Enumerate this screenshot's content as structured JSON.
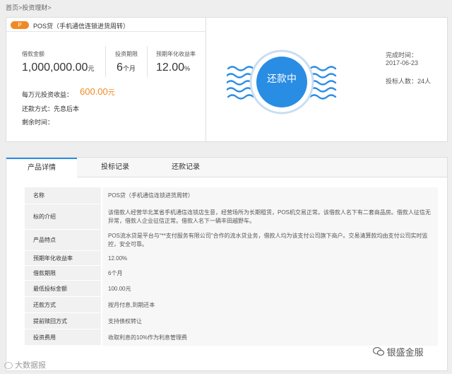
{
  "breadcrumb": {
    "home": "首页",
    "sep1": ">",
    "section": "投资理财",
    "sep2": ">"
  },
  "product": {
    "badge": "P",
    "name": "POS贷（手机通信连锁进货周转）"
  },
  "stats": {
    "amount_label": "借款金额",
    "amount_value": "1,000,000.00",
    "amount_unit": "元",
    "term_label": "投资期限",
    "term_value": "6",
    "term_unit": "个月",
    "rate_label": "预期年化收益率",
    "rate_value": "12.00",
    "rate_unit": "%"
  },
  "earnings": {
    "label": "每万元投资收益：",
    "value": "600.00",
    "unit": "元"
  },
  "repay": {
    "label": "还款方式：",
    "value": "先息后本"
  },
  "remaining": {
    "label": "剩余时间：",
    "value": ""
  },
  "status": {
    "stamp_text": "还款中",
    "stamp_color": "#2a8de4"
  },
  "meta": {
    "done_label": "完成时间：",
    "done_value": "2017-06-23",
    "investors_label": "投标人数：",
    "investors_value": "24人"
  },
  "tabs": [
    "产品详情",
    "投标记录",
    "还款记录"
  ],
  "details": [
    {
      "k": "名称",
      "v": "POS贷（手机通信连锁进货周转）"
    },
    {
      "k": "标的介绍",
      "v": "该借款人经营华北某省手机通信连锁店生意，经营场所为长期租赁，POS机交易正常。该借款人名下有二套商品房。借款人征信无异常，借款人企业征信正常。借款人名下一辆丰田越野车。"
    },
    {
      "k": "产品特点",
      "v": "POS流水贷是平台与“**支付服务有限公司”合作的流水贷业务，借款人均为该支付公司旗下商户。交易清算款均由支付公司实时监控，安全可靠。"
    },
    {
      "k": "预期年化收益率",
      "v": "12.00%"
    },
    {
      "k": "借款期限",
      "v": "6个月"
    },
    {
      "k": "最低投标金额",
      "v": "100.00元"
    },
    {
      "k": "还款方式",
      "v": "按月付息,到期还本"
    },
    {
      "k": "提前赎回方式",
      "v": "支持债权转让"
    },
    {
      "k": "投资费用",
      "v": "收取利息的10%作为利息管理费"
    }
  ],
  "watermarks": {
    "right": "银盛金服",
    "left": "大数据报"
  }
}
